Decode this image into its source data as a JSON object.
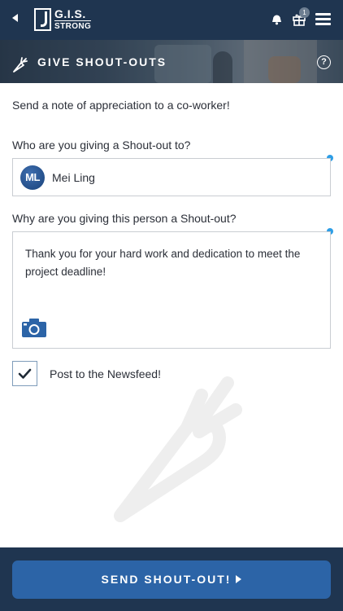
{
  "header": {
    "logo_line1": "G.I.S.",
    "logo_line2": "STRONG",
    "gift_badge_count": "1",
    "icons": [
      "back-icon",
      "bell-icon",
      "gift-icon",
      "menu-icon"
    ]
  },
  "banner": {
    "title": "GIVE SHOUT-OUTS",
    "icon": "carrot-icon",
    "help_label": "?"
  },
  "form": {
    "intro": "Send a note of appreciation to a co-worker!",
    "recipient_label": "Who are you giving a Shout-out to?",
    "recipient_initials": "ML",
    "recipient_name": "Mei Ling",
    "reason_label": "Why are you giving this person a Shout-out?",
    "reason_text": "Thank you for your hard work and dedication to meet the project deadline!",
    "camera_icon": "camera-icon",
    "post_newsfeed_checked": true,
    "post_newsfeed_label": "Post to the Newsfeed!"
  },
  "footer": {
    "send_label": "SEND SHOUT-OUT!"
  },
  "colors": {
    "navy": "#1f3550",
    "button_blue": "#2c64a7",
    "required_dot": "#2e9ee6"
  }
}
